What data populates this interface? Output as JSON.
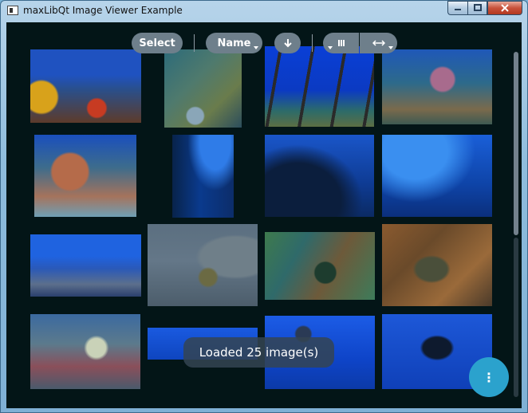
{
  "window": {
    "title": "maxLibQt Image Viewer Example"
  },
  "toolbar": {
    "select_label": "Select",
    "sort_label": "Name",
    "sort_direction_icon": "arrow-down-icon",
    "view_mode_icon": "grid-icon",
    "size_icon": "resize-horizontal-icon"
  },
  "status": {
    "message": "Loaded 25 image(s)"
  },
  "fab": {
    "icon": "more-vert-icon",
    "label": "⋮"
  },
  "colors": {
    "background": "#031517",
    "toolbar_pill": "#6e7f8b",
    "fab": "#2ba2cd",
    "toast": "#344452"
  }
}
